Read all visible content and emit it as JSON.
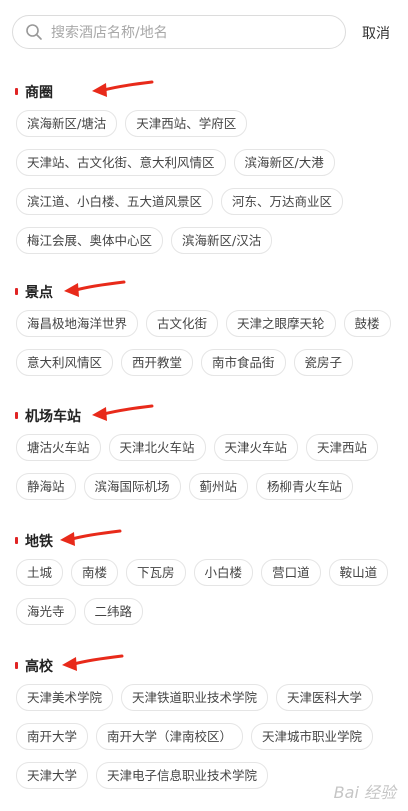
{
  "search": {
    "placeholder": "搜索酒店名称/地名"
  },
  "cancel_label": "取消",
  "accent_color": "#e02424",
  "sections": [
    {
      "title": "商圈",
      "rows": [
        [
          "滨海新区/塘沽",
          "天津西站、学府区"
        ],
        [
          "天津站、古文化街、意大利风情区",
          "滨海新区/大港"
        ],
        [
          "滨江道、小白楼、五大道风景区",
          "河东、万达商业区"
        ],
        [
          "梅江会展、奥体中心区",
          "滨海新区/汉沽"
        ]
      ]
    },
    {
      "title": "景点",
      "rows": [
        [
          "海昌极地海洋世界",
          "古文化街",
          "天津之眼摩天轮",
          "鼓楼"
        ],
        [
          "意大利风情区",
          "西开教堂",
          "南市食品街",
          "瓷房子"
        ]
      ]
    },
    {
      "title": "机场车站",
      "rows": [
        [
          "塘沽火车站",
          "天津北火车站",
          "天津火车站",
          "天津西站"
        ],
        [
          "静海站",
          "滨海国际机场",
          "蓟州站",
          "杨柳青火车站"
        ]
      ]
    },
    {
      "title": "地铁",
      "rows": [
        [
          "土城",
          "南楼",
          "下瓦房",
          "小白楼",
          "营口道",
          "鞍山道"
        ],
        [
          "海光寺",
          "二纬路"
        ]
      ]
    },
    {
      "title": "高校",
      "rows": [
        [
          "天津美术学院",
          "天津铁道职业技术学院",
          "天津医科大学"
        ],
        [
          "南开大学",
          "南开大学（津南校区）",
          "天津城市职业学院"
        ],
        [
          "天津大学",
          "天津电子信息职业技术学院"
        ]
      ]
    }
  ],
  "watermark": "Bai 经验"
}
